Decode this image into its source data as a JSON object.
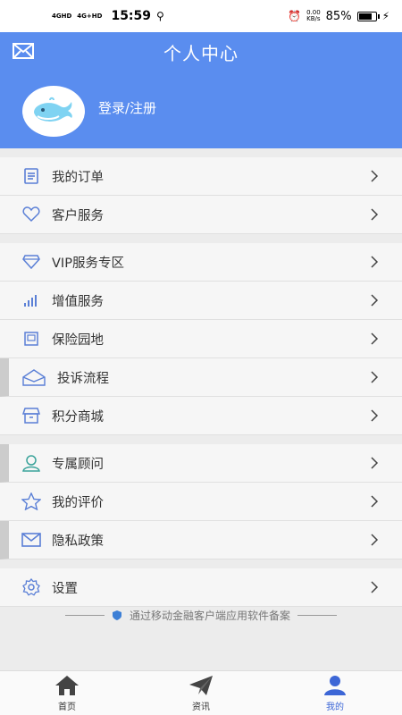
{
  "status_bar": {
    "network1": "4GHD",
    "network2": "4G+HD",
    "time": "15:59",
    "speed_value": "0.00",
    "speed_unit": "KB/s",
    "battery": "85%",
    "battery_level": 0.85
  },
  "header": {
    "title": "个人中心",
    "login_label": "登录/注册"
  },
  "menu_groups": [
    [
      {
        "label": "我的订单",
        "icon": "order-icon"
      },
      {
        "label": "客户服务",
        "icon": "heart-icon"
      }
    ],
    [
      {
        "label": "VIP服务专区",
        "icon": "diamond-icon"
      },
      {
        "label": "增值服务",
        "icon": "bar-chart-icon"
      },
      {
        "label": "保险园地",
        "icon": "book-icon"
      },
      {
        "label": "投诉流程",
        "icon": "envelope-open-icon"
      },
      {
        "label": "积分商城",
        "icon": "store-icon"
      }
    ],
    [
      {
        "label": "专属顾问",
        "icon": "user-icon"
      },
      {
        "label": "我的评价",
        "icon": "star-icon"
      },
      {
        "label": "隐私政策",
        "icon": "mail-icon"
      }
    ],
    [
      {
        "label": "设置",
        "icon": "gear-icon"
      }
    ]
  ],
  "footnote": "通过移动金融客户端应用软件备案",
  "tabs": [
    {
      "label": "首页",
      "icon": "home-icon"
    },
    {
      "label": "资讯",
      "icon": "paper-plane-icon"
    },
    {
      "label": "我的",
      "icon": "person-icon"
    }
  ],
  "colors": {
    "header": "#5a8def",
    "accent": "#3c66d6",
    "icon": "#5a7fd6"
  }
}
